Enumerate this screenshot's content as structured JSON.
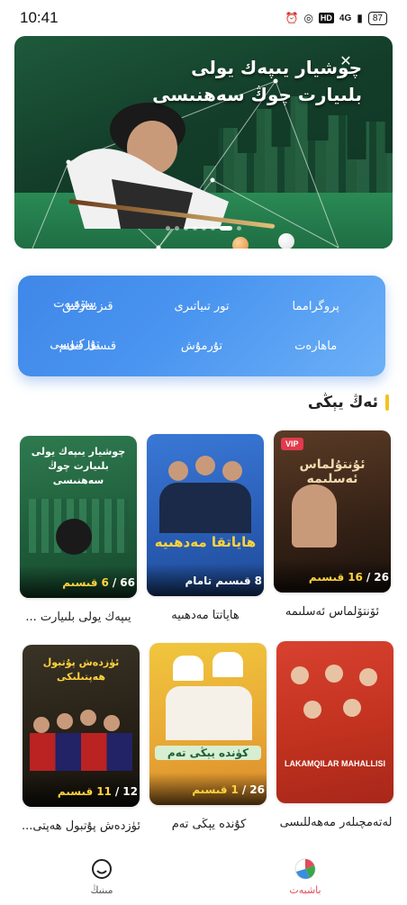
{
  "status_bar": {
    "time": "10:41",
    "hd": "HD",
    "signal": "4G",
    "battery": "87"
  },
  "banner": {
    "title_line1": "چوشيار يىپەك يولى",
    "title_line2": "بلىيارت چوڭ سەھنىسى",
    "close_icon": "close-icon",
    "dot_count": 8,
    "active_dot": 6
  },
  "categories": [
    "پروگرامما",
    "تور تىياتىرى",
    "قىزىقارلىق",
    "سۆھبەت",
    "ماھارەت",
    "تۇرمۇش",
    "قىسقا فىلىم",
    "تۇركنوسى"
  ],
  "section": {
    "title": "ئەڭ يېڭى"
  },
  "cards": [
    {
      "caption": "ئۆنتۆلماس ئەسلىمە",
      "ep_total": "26",
      "ep_current": "16",
      "ep_word": "قىسىم",
      "vip": "VIP",
      "art_title": "ئۇنتۇلماس ئەسلىمە"
    },
    {
      "caption": "ھاياتتا مەدھىيە",
      "ep_total": "8",
      "ep_current": "",
      "ep_word": "قىسىم تامام",
      "vip": "",
      "art_title": "ھاياتقا مەدھىيە"
    },
    {
      "caption": "يىپەك يولى بلىيارت ...",
      "ep_total": "66",
      "ep_current": "6",
      "ep_word": "قىسىم",
      "vip": "",
      "art_title": "چوشيار يىپەك يولى بلىيارت چوڭ سەھنىسى"
    },
    {
      "caption": "لەتەمچىلەر مەھەللىسى",
      "ep_total": "",
      "ep_current": "",
      "ep_word": "",
      "vip": "",
      "art_title": "LAKAMQILAR MAHALLISI"
    },
    {
      "caption": "كۇندە يېڭى تەم",
      "ep_total": "26",
      "ep_current": "1",
      "ep_word": "قىسىم",
      "vip": "",
      "art_title": "كۈندە يېڭى تەم"
    },
    {
      "caption": "ئۈزدەش پۇتبول ھەپتى...",
      "ep_total": "12",
      "ep_current": "11",
      "ep_word": "قىسىم",
      "vip": "",
      "art_title": "ئۈزدەش پۇتبول ھەپتىلىكى"
    }
  ],
  "tabs": [
    {
      "label": "مىنىڭ",
      "icon": "profile-icon",
      "active": false
    },
    {
      "label": "باشبەت",
      "icon": "home-icon",
      "active": true
    }
  ],
  "colors": {
    "accent_yellow": "#f4c21f",
    "panel_blue": "#4a95f0",
    "active_tab": "#e24a5a",
    "episode_highlight": "#ffd33d"
  }
}
